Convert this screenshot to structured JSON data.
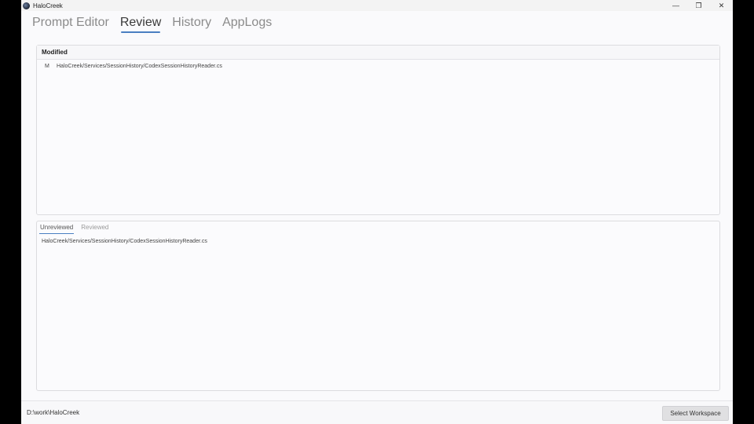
{
  "window": {
    "title": "HaloCreek",
    "controls": {
      "minimize": "—",
      "restore": "❐",
      "close": "✕"
    }
  },
  "tabs": [
    {
      "label": "Prompt Editor",
      "active": false
    },
    {
      "label": "Review",
      "active": true
    },
    {
      "label": "History",
      "active": false
    },
    {
      "label": "AppLogs",
      "active": false
    }
  ],
  "modified_panel": {
    "header": "Modified",
    "files": [
      {
        "status": "M",
        "path": "HaloCreek/Services/SessionHistory/CodexSessionHistoryReader.cs"
      }
    ]
  },
  "review_panel": {
    "tabs": [
      {
        "label": "Unreviewed",
        "active": true
      },
      {
        "label": "Reviewed",
        "active": false
      }
    ],
    "items": [
      "HaloCreek/Services/SessionHistory/CodexSessionHistoryReader.cs"
    ]
  },
  "footer": {
    "workspace_path": "D:\\work\\HaloCreek",
    "select_workspace_label": "Select Workspace"
  },
  "colors": {
    "accent": "#4a7fc1",
    "background": "#fafafc"
  }
}
